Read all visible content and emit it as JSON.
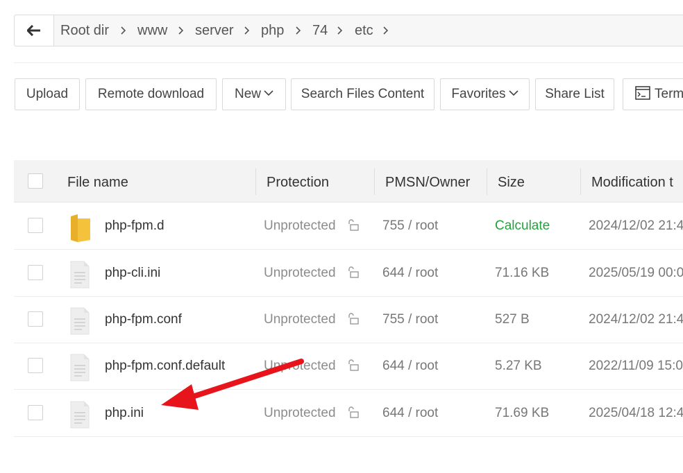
{
  "breadcrumb": {
    "items": [
      "Root dir",
      "www",
      "server",
      "php",
      "74",
      "etc"
    ]
  },
  "toolbar": {
    "upload": "Upload",
    "remote_download": "Remote download",
    "new": "New",
    "search_content": "Search Files Content",
    "favorites": "Favorites",
    "share_list": "Share List",
    "terminal": "Term"
  },
  "table": {
    "headers": {
      "name": "File name",
      "protection": "Protection",
      "perm_owner": "PMSN/Owner",
      "size": "Size",
      "modified": "Modification t"
    },
    "rows": [
      {
        "type": "folder",
        "name": "php-fpm.d",
        "protection": "Unprotected",
        "perm_owner": "755 / root",
        "size": "Calculate",
        "modified": "2024/12/02 21:4"
      },
      {
        "type": "file",
        "name": "php-cli.ini",
        "protection": "Unprotected",
        "perm_owner": "644 / root",
        "size": "71.16 KB",
        "modified": "2025/05/19 00:0"
      },
      {
        "type": "file",
        "name": "php-fpm.conf",
        "protection": "Unprotected",
        "perm_owner": "755 / root",
        "size": "527 B",
        "modified": "2024/12/02 21:4"
      },
      {
        "type": "file",
        "name": "php-fpm.conf.default",
        "protection": "Unprotected",
        "perm_owner": "644 / root",
        "size": "5.27 KB",
        "modified": "2022/11/09 15:0"
      },
      {
        "type": "file",
        "name": "php.ini",
        "protection": "Unprotected",
        "perm_owner": "644 / root",
        "size": "71.69 KB",
        "modified": "2025/04/18 12:4"
      }
    ]
  },
  "colors": {
    "accent_green": "#20a53a",
    "annotation_arrow": "#e8141b",
    "folder": "#f5c23c"
  },
  "icons": {
    "back": "arrow-left-icon",
    "separator": "chevron-right-icon",
    "folder": "folder-icon",
    "file": "file-icon",
    "lock": "unlock-icon",
    "terminal": "terminal-icon"
  }
}
